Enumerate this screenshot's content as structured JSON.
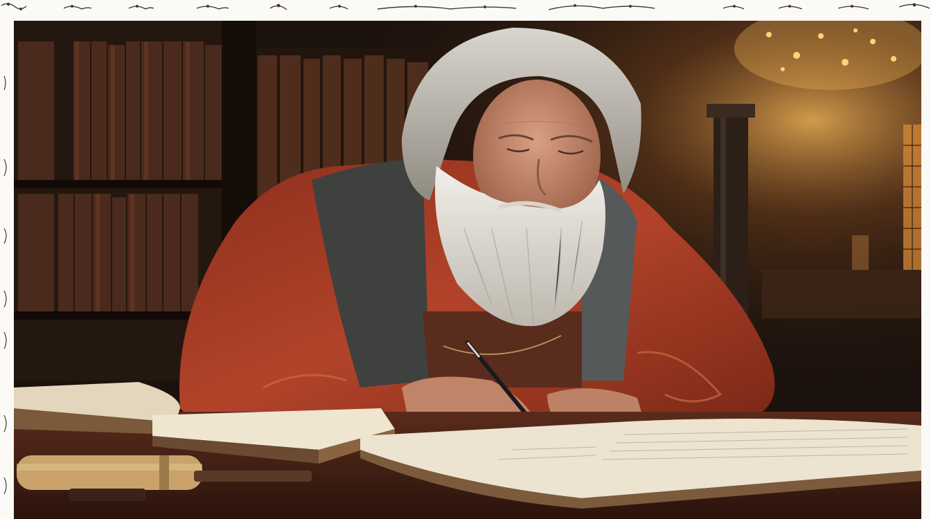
{
  "image": {
    "subject": "elderly-scholar-writing",
    "palette": {
      "background_dark": "#1c120d",
      "shelf_wood": "#2a1a12",
      "book_spines": "#5a3424",
      "robe_red": "#a63b25",
      "vest_gray": "#4c4e4b",
      "beard_white": "#e6e3dc",
      "skin": "#c98e70",
      "paper": "#ece3d1",
      "desk": "#4a2318",
      "warm_light": "#f2b457",
      "frame": "#fbfaf6",
      "ornament_ink": "#3d3a2f"
    },
    "decorations": [
      "vine-ornament-icon"
    ]
  }
}
